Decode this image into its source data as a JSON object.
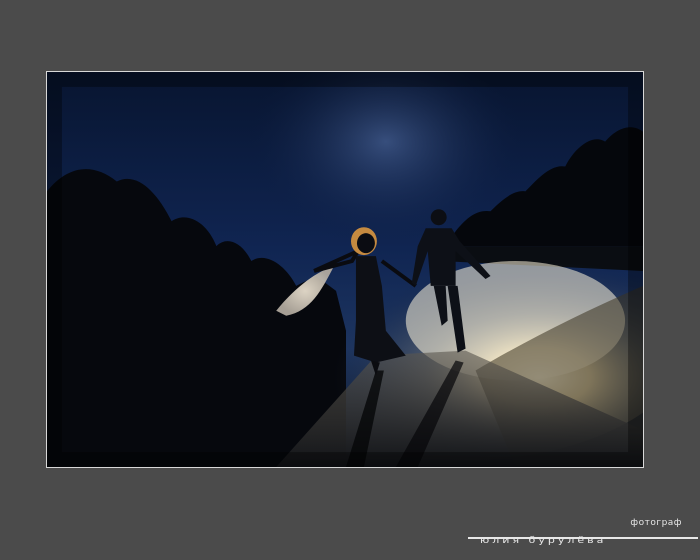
{
  "photo": {
    "subject": "couple-running-on-foggy-road-at-night",
    "colors": {
      "sky": "#0b1a3c",
      "fog_glow": "#f2e3bd",
      "ground": "#16181c",
      "frame_border": "#d8d8d8",
      "background": "#4b4b4b"
    }
  },
  "credit": {
    "role": "фотограф",
    "name": "юлия бурулёва"
  }
}
